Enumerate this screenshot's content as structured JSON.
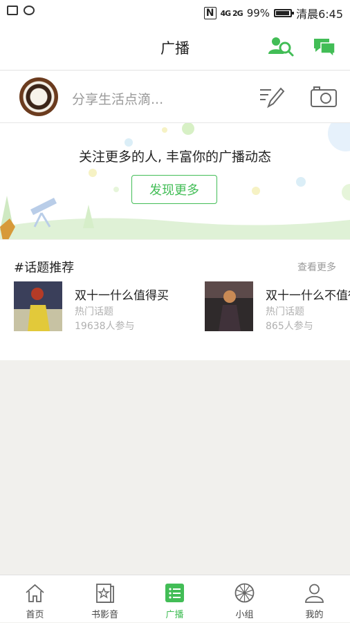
{
  "status_bar": {
    "battery": "99%",
    "time": "清晨6:45",
    "network": "4G 2G"
  },
  "header": {
    "title": "广播"
  },
  "compose": {
    "placeholder": "分享生活点滴..."
  },
  "banner": {
    "message": "关注更多的人, 丰富你的广播动态",
    "discover_button": "发现更多"
  },
  "topics": {
    "heading": "#话题推荐",
    "more_link": "查看更多",
    "items": [
      {
        "title": "双十一什么值得买",
        "subtitle": "热门话题",
        "count": "19638人参与"
      },
      {
        "title": "双十一什么不值得",
        "subtitle": "热门话题",
        "count": "865人参与"
      }
    ]
  },
  "tabs": [
    {
      "label": "首页",
      "icon": "home-icon"
    },
    {
      "label": "书影音",
      "icon": "media-icon"
    },
    {
      "label": "广播",
      "icon": "broadcast-icon",
      "active": true
    },
    {
      "label": "小组",
      "icon": "group-icon"
    },
    {
      "label": "我的",
      "icon": "profile-icon"
    }
  ],
  "colors": {
    "accent": "#42bd56",
    "background": "#f1f0ed"
  }
}
